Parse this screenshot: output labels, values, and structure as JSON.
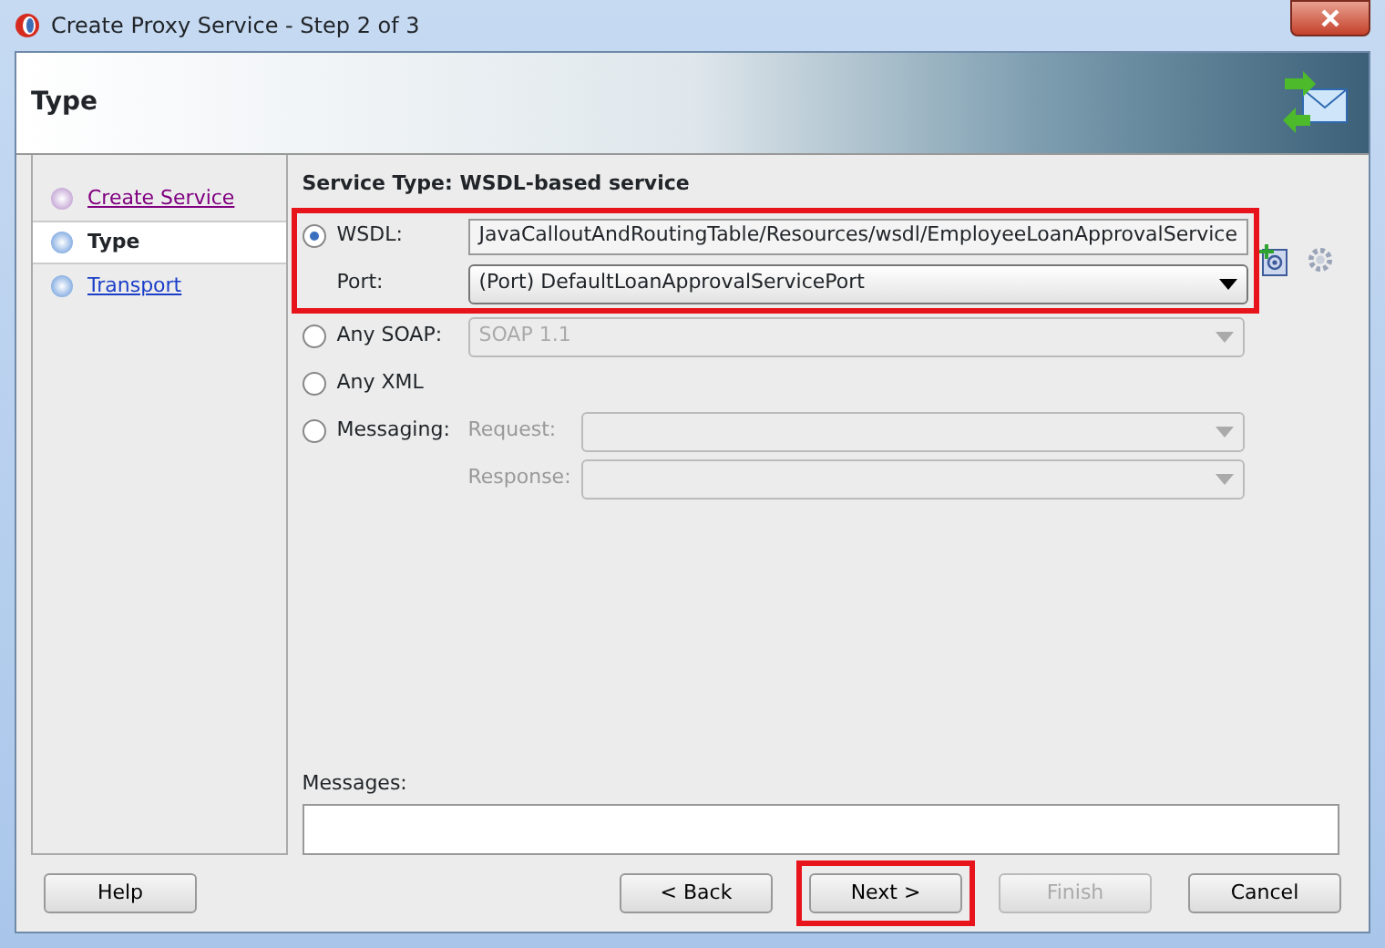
{
  "window": {
    "title": "Create Proxy Service - Step 2 of 3"
  },
  "header": {
    "title": "Type"
  },
  "steps": [
    {
      "label": "Create Service",
      "selected": false,
      "visited": true
    },
    {
      "label": "Type",
      "selected": true,
      "visited": false
    },
    {
      "label": "Transport",
      "selected": false,
      "visited": false
    }
  ],
  "service_type": "Service Type: WSDL-based service",
  "options": [
    {
      "kind": "wsdl",
      "label": "WSDL:",
      "selected": true,
      "highlighted": true,
      "value": "JavaCalloutAndRoutingTable/Resources/wsdl/EmployeeLoanApprovalService",
      "port_label": "Port:",
      "port_value": "(Port) DefaultLoanApprovalServicePort"
    },
    {
      "kind": "select",
      "label": "Any SOAP:",
      "selected": false,
      "highlighted": false,
      "disabled": true,
      "value": "SOAP 1.1"
    },
    {
      "kind": "plain",
      "label": "Any XML",
      "selected": false,
      "highlighted": false
    },
    {
      "kind": "messaging",
      "label": "Messaging:",
      "selected": false,
      "highlighted": false,
      "disabled": true,
      "request_label": "Request:",
      "response_label": "Response:"
    }
  ],
  "messages": {
    "label": "Messages:"
  },
  "buttons": [
    {
      "label": "Help",
      "disabled": false,
      "highlighted": false
    },
    {
      "label": "< Back",
      "disabled": false,
      "highlighted": false
    },
    {
      "label": "Next >",
      "disabled": false,
      "highlighted": true
    },
    {
      "label": "Finish",
      "disabled": true,
      "highlighted": false
    },
    {
      "label": "Cancel",
      "disabled": false,
      "highlighted": false
    }
  ]
}
